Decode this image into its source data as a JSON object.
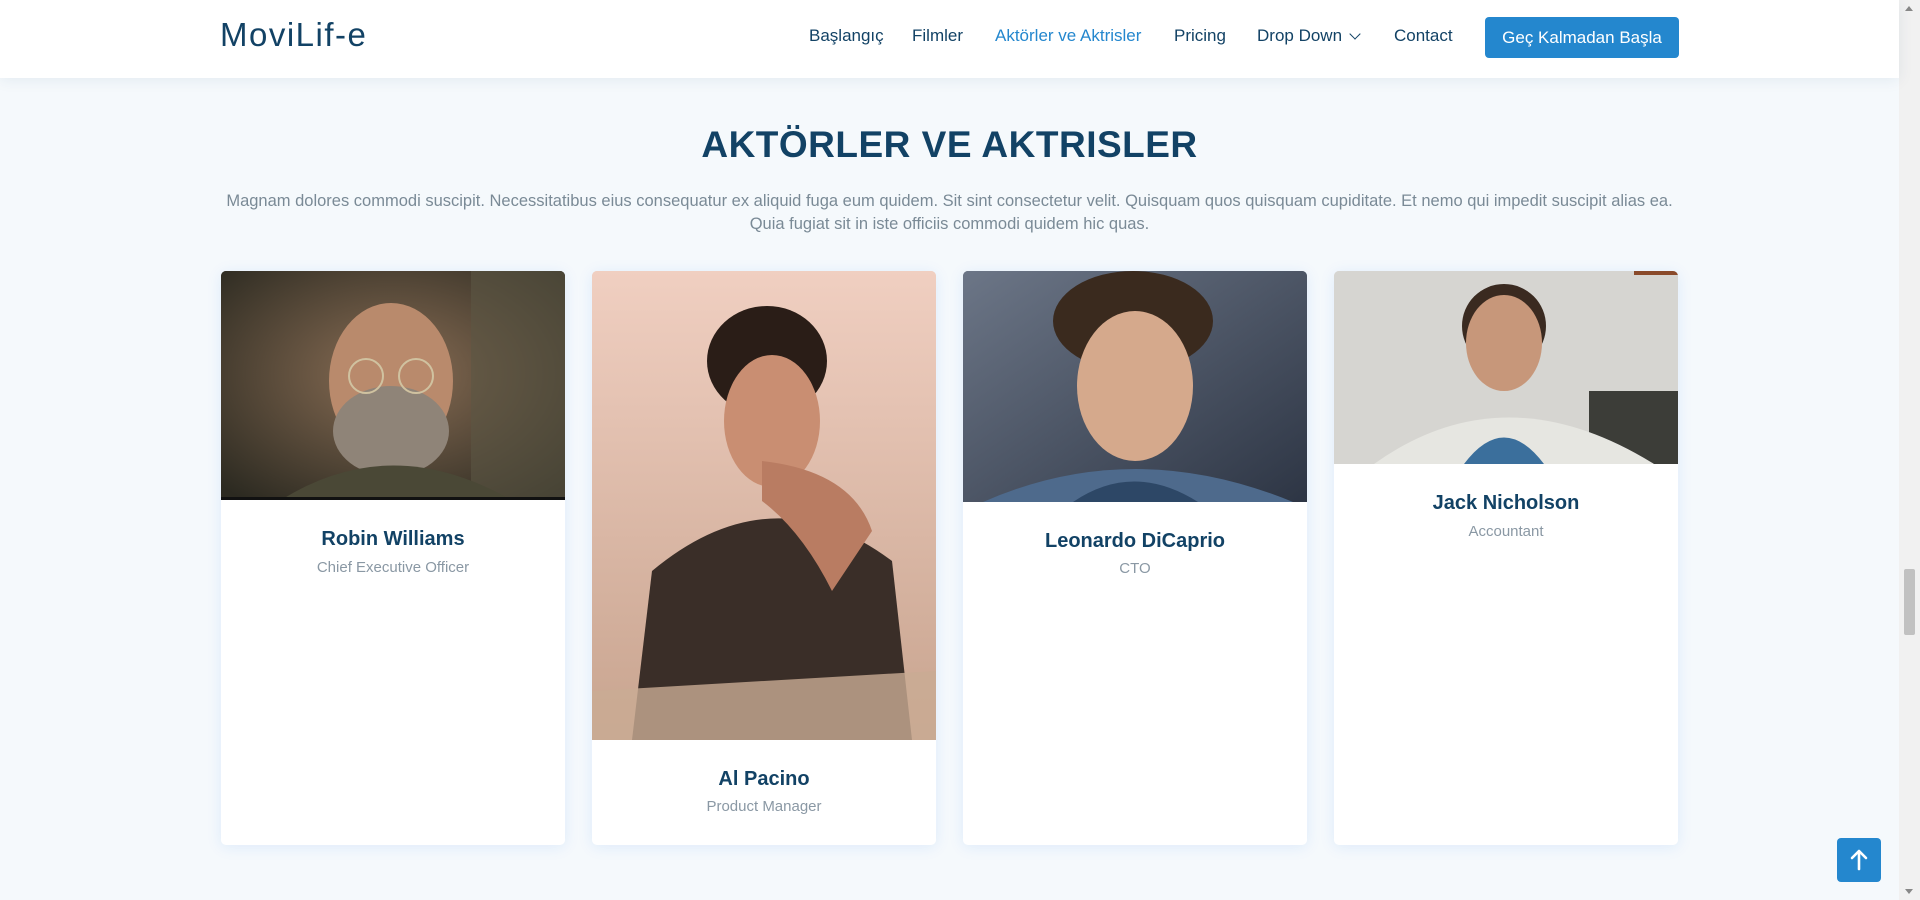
{
  "header": {
    "logo": "MoviLif-e",
    "nav": [
      {
        "label": "Başlangıç",
        "active": false
      },
      {
        "label": "Filmler",
        "active": false
      },
      {
        "label": "Aktörler ve Aktrisler",
        "active": true
      },
      {
        "label": "Pricing",
        "active": false
      },
      {
        "label": "Drop Down",
        "active": false
      },
      {
        "label": "Contact",
        "active": false
      }
    ],
    "cta_label": "Geç Kalmadan Başla"
  },
  "section": {
    "title": "AKTÖRLER VE AKTRISLER",
    "description": "Magnam dolores commodi suscipit. Necessitatibus eius consequatur ex aliquid fuga eum quidem. Sit sint consectetur velit. Quisquam quos quisquam cupiditate. Et nemo qui impedit suscipit alias ea. Quia fugiat sit in iste officiis commodi quidem hic quas."
  },
  "team": [
    {
      "name": "Robin Williams",
      "role": "Chief Executive Officer"
    },
    {
      "name": "Al Pacino",
      "role": "Product Manager"
    },
    {
      "name": "Leonardo DiCaprio",
      "role": "CTO"
    },
    {
      "name": "Jack Nicholson",
      "role": "Accountant"
    }
  ],
  "icons": {
    "dropdown": "chevron-down-icon",
    "back_to_top": "arrow-up-icon"
  },
  "colors": {
    "accent": "#2487ce",
    "heading": "#124265",
    "muted": "#7a8a96",
    "background": "#f5f9fc"
  }
}
